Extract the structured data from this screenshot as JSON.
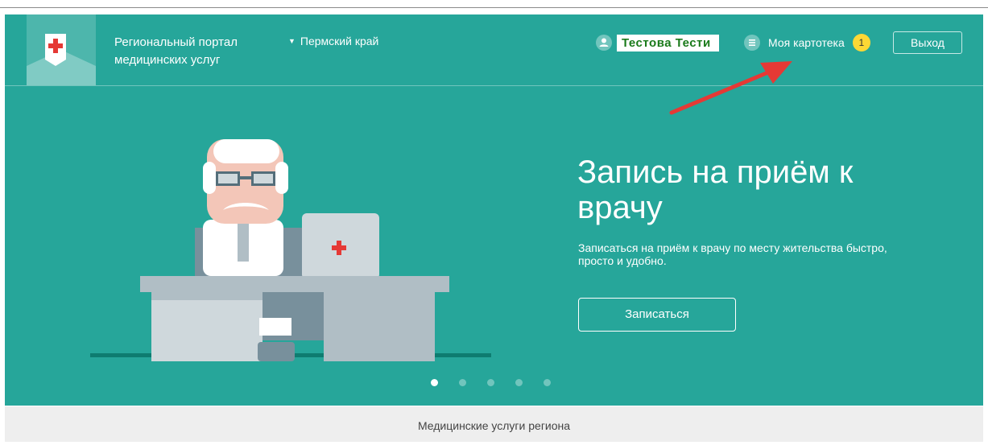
{
  "header": {
    "brand_line1": "Региональный портал",
    "brand_line2": "медицинских услуг",
    "region": "Пермский край",
    "user_name": "Тестова Тести",
    "cards_label": "Моя картотека",
    "notifications_count": "1",
    "logout_label": "Выход"
  },
  "hero": {
    "title": "Запись на приём к врачу",
    "description": "Записаться на приём к врачу по месту жительства быстро, просто и удобно.",
    "button_label": "Записаться"
  },
  "slider": {
    "slide_count": 5,
    "active_slide": 1
  },
  "footer": {
    "text": "Медицинские услуги региона"
  },
  "colors": {
    "primary": "#26a69a",
    "logo_bg": "#4db6ac",
    "badge": "#fdd835",
    "annotation_arrow": "#e53935",
    "footer_bg": "#eeeeee"
  },
  "icons": {
    "logo": "medical-cross-shield-icon",
    "user": "user-icon",
    "cards": "list-icon",
    "region": "triangle-down-icon"
  }
}
